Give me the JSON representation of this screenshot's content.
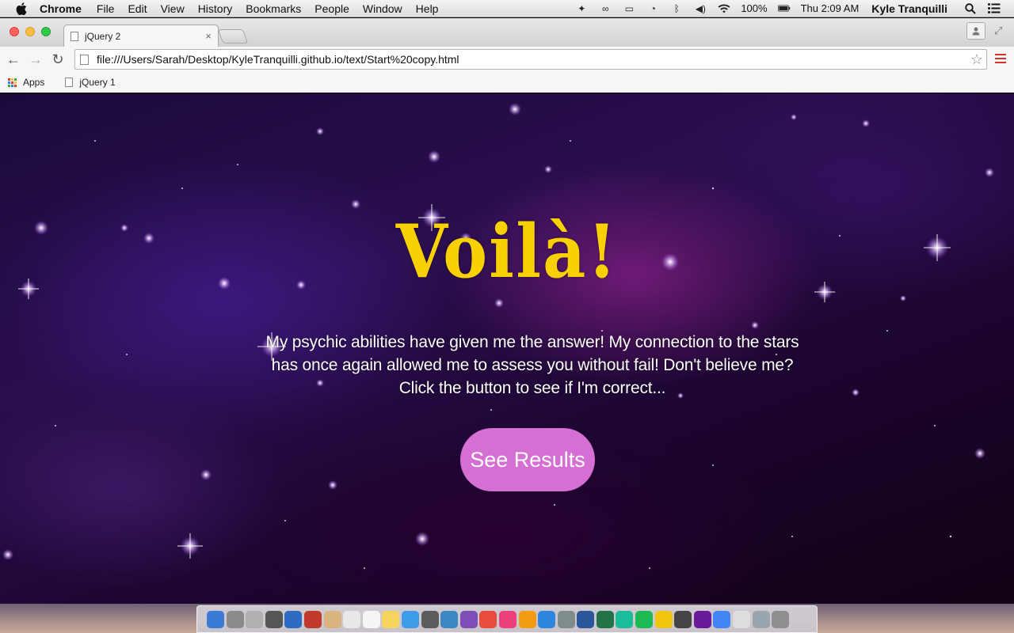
{
  "menubar": {
    "app_name": "Chrome",
    "items": [
      "File",
      "Edit",
      "View",
      "History",
      "Bookmarks",
      "People",
      "Window",
      "Help"
    ],
    "battery": "100%",
    "clock": "Thu 2:09 AM",
    "user": "Kyle Tranquilli"
  },
  "browser": {
    "tab_title": "jQuery 2",
    "tab_close": "×",
    "url": "file:///Users/Sarah/Desktop/KyleTranquilli.github.io/text/Start%20copy.html",
    "bookmarks": [
      "Apps",
      "jQuery 1"
    ]
  },
  "page": {
    "headline": "Voilà!",
    "message": "My psychic abilities have given me the answer! My connection to the stars has once again allowed me to assess you without fail! Don't believe me? Click the button to see if I'm correct...",
    "button_label": "See Results",
    "accent_color": "#f9d000",
    "button_color": "#d56fd3"
  },
  "dock": {
    "icon_colors": [
      "#3a7bd5",
      "#8a8a8a",
      "#b0b0b0",
      "#555555",
      "#2d6cc0",
      "#c0392b",
      "#d9b680",
      "#e8e8e8",
      "#f5f5f5",
      "#f4d35e",
      "#3d9be9",
      "#5c5c5c",
      "#3b88c3",
      "#7d4fb6",
      "#e74c3c",
      "#ec407a",
      "#f39c12",
      "#2e86de",
      "#7f8c8d",
      "#2b579a",
      "#217346",
      "#1abc9c",
      "#1db954",
      "#f1c40f",
      "#444444",
      "#6a1b9a",
      "#4285f4",
      "#dddddd",
      "#9aa4ad",
      "#8e8e8e"
    ]
  }
}
